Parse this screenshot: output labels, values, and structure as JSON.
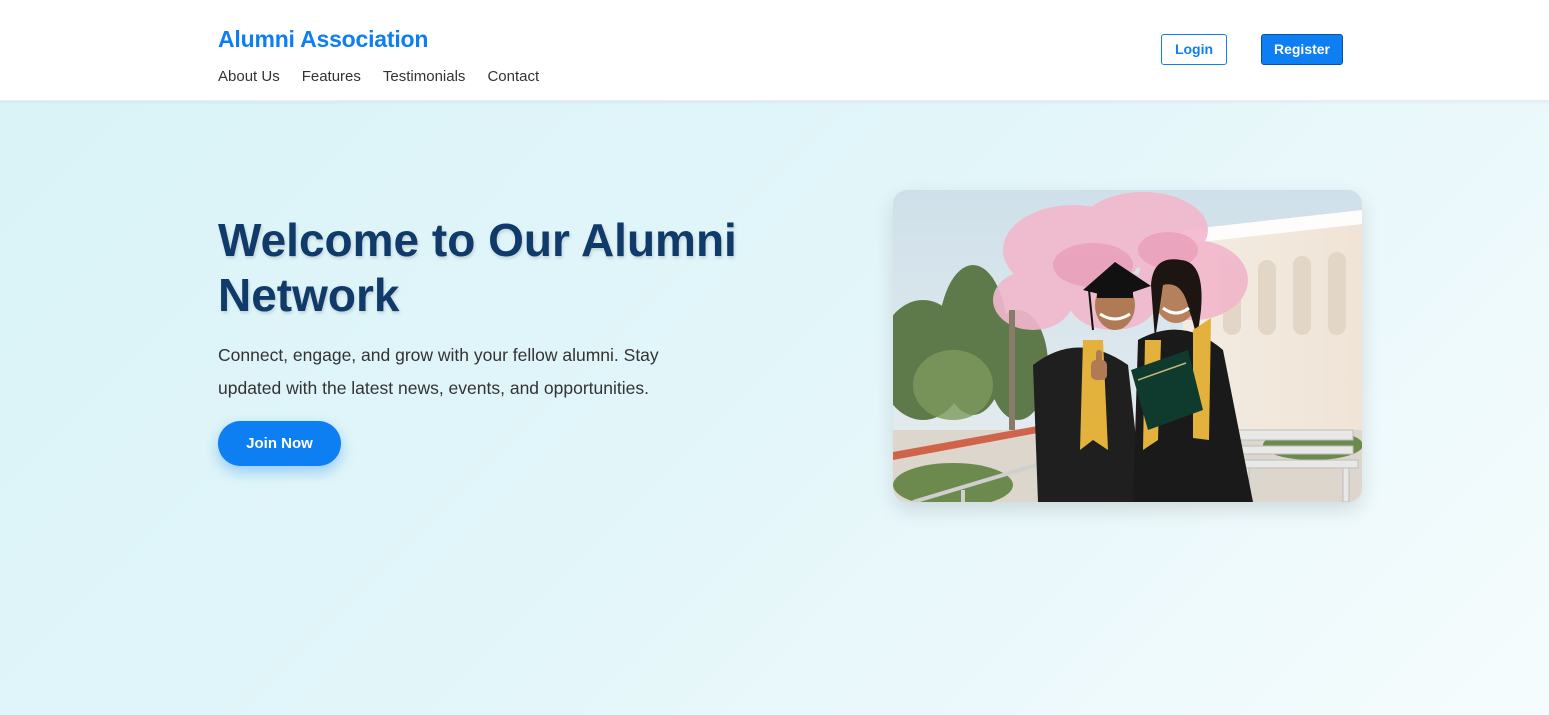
{
  "header": {
    "brand": "Alumni Association",
    "nav": [
      {
        "label": "About Us"
      },
      {
        "label": "Features"
      },
      {
        "label": "Testimonials"
      },
      {
        "label": "Contact"
      }
    ],
    "login_label": "Login",
    "register_label": "Register"
  },
  "hero": {
    "title": "Welcome to Our Alumni Network",
    "text": "Connect, engage, and grow with your fellow alumni. Stay updated with the latest news, events, and opportunities.",
    "cta_label": "Join Now",
    "image_alt": "Two graduates in caps and gowns"
  },
  "colors": {
    "accent": "#0d7ff2",
    "title": "#0f3a6a"
  }
}
